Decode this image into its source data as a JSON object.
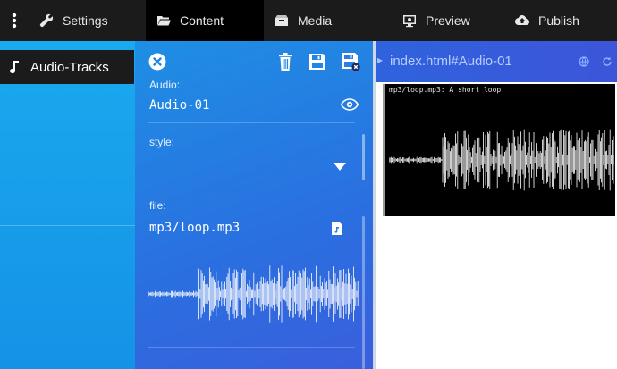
{
  "nav": {
    "settings": "Settings",
    "content": "Content",
    "media": "Media",
    "preview": "Preview",
    "publish": "Publish"
  },
  "sidebar": {
    "items": [
      {
        "label": "Audio-Tracks",
        "icon": "music-note-icon"
      }
    ]
  },
  "editor": {
    "audio_label": "Audio:",
    "audio_value": "Audio-01",
    "style_label": "style:",
    "style_value": "",
    "file_label": "file:",
    "file_value": "mp3/loop.mp3"
  },
  "preview": {
    "url": "index.html#Audio-01",
    "caption": "mp3/loop.mp3: A short loop"
  },
  "colors": {
    "accent": "#1aa9ee",
    "topbar": "#1b1b1b",
    "active_tab": "#000000",
    "preview_header": "#3558db"
  }
}
